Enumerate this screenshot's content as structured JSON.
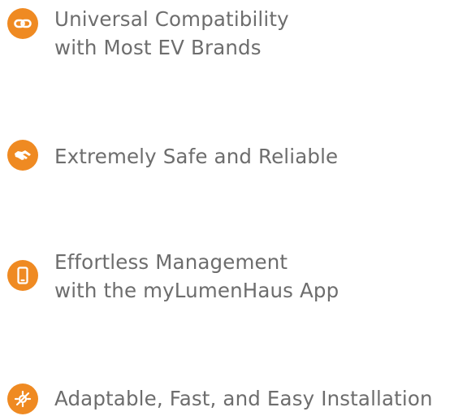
{
  "features": [
    {
      "icon": "link-icon",
      "lines": [
        "Universal Compatibility",
        "with Most EV Brands"
      ]
    },
    {
      "icon": "handshake-icon",
      "lines": [
        "Extremely Safe and Reliable"
      ]
    },
    {
      "icon": "smartphone-icon",
      "lines": [
        "Effortless Management",
        "with the myLumenHaus App"
      ]
    },
    {
      "icon": "installation-tools-icon",
      "lines": [
        "Adaptable, Fast, and Easy Installation"
      ]
    }
  ],
  "colors": {
    "accent": "#ef8a22",
    "text": "#6d6d6d",
    "background": "#ffffff"
  }
}
